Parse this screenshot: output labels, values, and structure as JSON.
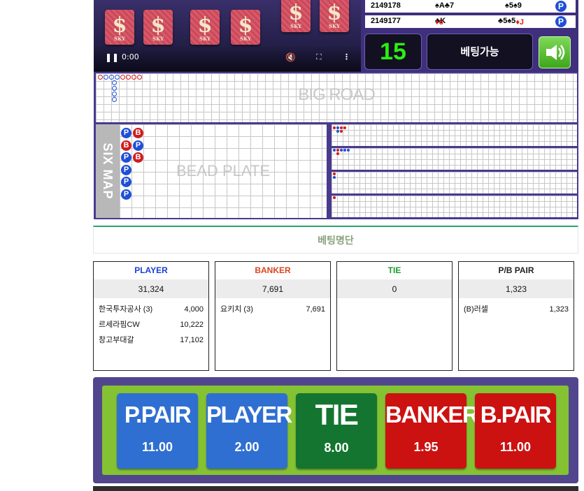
{
  "video": {
    "time": "0:00",
    "card_symbol": "$",
    "card_text": "SKY"
  },
  "history": [
    {
      "round": "2149178",
      "player_cards": "♠A♣7",
      "banker_cards": "♠5♠9",
      "result": "P"
    },
    {
      "round": "2149177",
      "player_cards": "♦6♣K",
      "banker_cards": "♣5♠5♦J",
      "result": "P"
    }
  ],
  "countdown": "15",
  "status": "베팅가능",
  "roads": {
    "big_road_label": "BIG ROAD",
    "six_map_label": "SIX MAP",
    "bead_plate_label": "BEAD PLATE",
    "bead_columns": [
      [
        "P",
        "B",
        "P",
        "P",
        "P",
        "P"
      ],
      [
        "B",
        "P",
        "B"
      ]
    ]
  },
  "betting_list": {
    "title": "베팅명단",
    "columns": [
      {
        "header": "PLAYER",
        "color": "#1a3fd6",
        "total": "31,324",
        "rows": [
          {
            "name": "한국투자공사 (3)",
            "amount": "4,000"
          },
          {
            "name": "르세라핌CW",
            "amount": "10,222"
          },
          {
            "name": "창고부대갈",
            "amount": "17,102"
          }
        ]
      },
      {
        "header": "BANKER",
        "color": "#d9451f",
        "total": "7,691",
        "rows": [
          {
            "name": "요키치 (3)",
            "amount": "7,691"
          }
        ]
      },
      {
        "header": "TIE",
        "color": "#1c9a2b",
        "total": "0",
        "rows": []
      },
      {
        "header": "P/B PAIR",
        "color": "#222222",
        "total": "1,323",
        "rows": [
          {
            "name": "(B)러셀",
            "amount": "1,323"
          }
        ]
      }
    ]
  },
  "bets": [
    {
      "label": "P.PAIR",
      "odds": "11.00",
      "color": "#2f6fd1"
    },
    {
      "label": "PLAYER",
      "odds": "2.00",
      "color": "#2f6fd1"
    },
    {
      "label": "TIE",
      "odds": "8.00",
      "color": "#13752f"
    },
    {
      "label": "BANKER",
      "odds": "1.95",
      "color": "#cc1111"
    },
    {
      "label": "B.PAIR",
      "odds": "11.00",
      "color": "#cc1111"
    }
  ]
}
